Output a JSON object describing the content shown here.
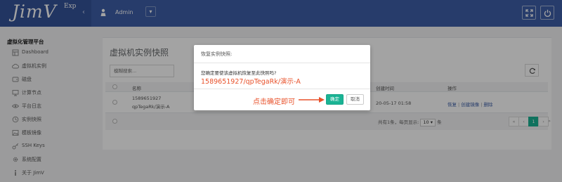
{
  "app": {
    "logo": "JimV",
    "logo_sup": "Exp"
  },
  "header": {
    "user": "Admin",
    "icons": [
      "user-icon",
      "chevron-down-icon",
      "fullscreen-icon",
      "power-icon"
    ]
  },
  "sidebar": {
    "section_title": "虚拟化管理平台",
    "items": [
      {
        "label": "Dashboard",
        "icon": "dashboard-icon"
      },
      {
        "label": "虚拟机实例",
        "icon": "cloud-icon"
      },
      {
        "label": "磁盘",
        "icon": "disk-icon"
      },
      {
        "label": "计算节点",
        "icon": "monitor-icon"
      },
      {
        "label": "平台日志",
        "icon": "eye-icon"
      },
      {
        "label": "实例快照",
        "icon": "snapshot-icon"
      },
      {
        "label": "模板镜像",
        "icon": "image-icon"
      },
      {
        "label": "SSH Keys",
        "icon": "key-icon"
      },
      {
        "label": "系统配置",
        "icon": "gear-icon"
      },
      {
        "label": "关于 JimV",
        "icon": "info-icon"
      }
    ]
  },
  "main": {
    "title": "虚拟机实例快照",
    "search_placeholder": "模糊搜索...",
    "table": {
      "headers": {
        "name": "名称",
        "created": "创建时间",
        "actions": "操作"
      },
      "rows": [
        {
          "id": "1589651927",
          "name": "qpTegaRk/演示-A",
          "created": "20-05-17 01:58",
          "actions": [
            "恢复",
            "创建镜像",
            "删除"
          ]
        }
      ]
    },
    "footer": {
      "total_text": "共有1条，每页显示:",
      "per_page": "10",
      "per_page_suffix": "条",
      "pages": [
        "«",
        "‹",
        "1",
        "›",
        "»"
      ],
      "current_page": "1"
    }
  },
  "modal": {
    "title": "恢复实例快照:",
    "question": "您确定要使该虚拟机恢复至此快照吗?",
    "target": "1589651927/qpTegaRk/演示-A",
    "ok_label": "确定",
    "cancel_label": "取消"
  },
  "annotation": {
    "text": "点击确定即可",
    "color": "#e8512a"
  },
  "colors": {
    "header": "#3d5fa8",
    "accent_green": "#1ab394",
    "link": "#3d5fa8",
    "annotation": "#e8512a"
  }
}
